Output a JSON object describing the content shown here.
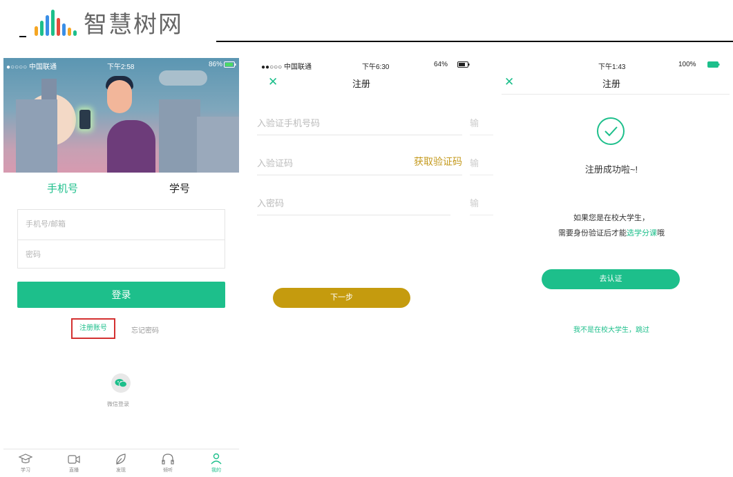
{
  "brand": {
    "name": "智慧树网",
    "bar_colors": [
      "#f5a623",
      "#1dbf8b",
      "#3a8ee6",
      "#1dbf8b",
      "#e74c3c",
      "#3a8ee6",
      "#f5a623",
      "#1dbf8b"
    ]
  },
  "screen1": {
    "status": {
      "carrier": "●○○○○ 中国联通",
      "time": "下午2:58",
      "battery": "86%"
    },
    "tabs": {
      "phone": "手机号",
      "student_id": "学号"
    },
    "inputs": {
      "account_placeholder": "手机号/邮箱",
      "password_placeholder": "密码"
    },
    "login_button": "登录",
    "register_link": "注册账号",
    "forgot_link": "忘记密码",
    "wechat_label": "微信登录",
    "nav": [
      {
        "label": "学习",
        "icon": "graduation-cap-icon"
      },
      {
        "label": "直播",
        "icon": "video-camera-icon"
      },
      {
        "label": "发现",
        "icon": "leaf-icon"
      },
      {
        "label": "倾听",
        "icon": "headphones-icon"
      },
      {
        "label": "我的",
        "icon": "user-icon",
        "active": true
      }
    ],
    "colors": {
      "accent": "#1dbf8b",
      "highlight_box": "#d32f2f"
    }
  },
  "screen2": {
    "status": {
      "carrier": "●●○○○ 中国联通",
      "time": "下午6:30",
      "battery": "64%"
    },
    "title": "注册",
    "fields": {
      "phone_placeholder": "入验证手机号码",
      "code_placeholder": "入验证码",
      "code_button": "获取验证码",
      "password_placeholder": "入密码"
    },
    "ghost_labels": [
      "输",
      "输",
      "输"
    ],
    "next_button": "下一步",
    "colors": {
      "accent": "#c59b0e"
    }
  },
  "screen3": {
    "status": {
      "time": "下午1:43",
      "battery": "100%"
    },
    "title": "注册",
    "success": "注册成功啦~!",
    "info_line1": "如果您是在校大学生，",
    "info_line2_prefix": "需要身份验证后才能",
    "info_line2_highlight": "选学分课",
    "info_line2_suffix": "哦",
    "verify_button": "去认证",
    "skip_link": "我不是在校大学生，跳过"
  }
}
